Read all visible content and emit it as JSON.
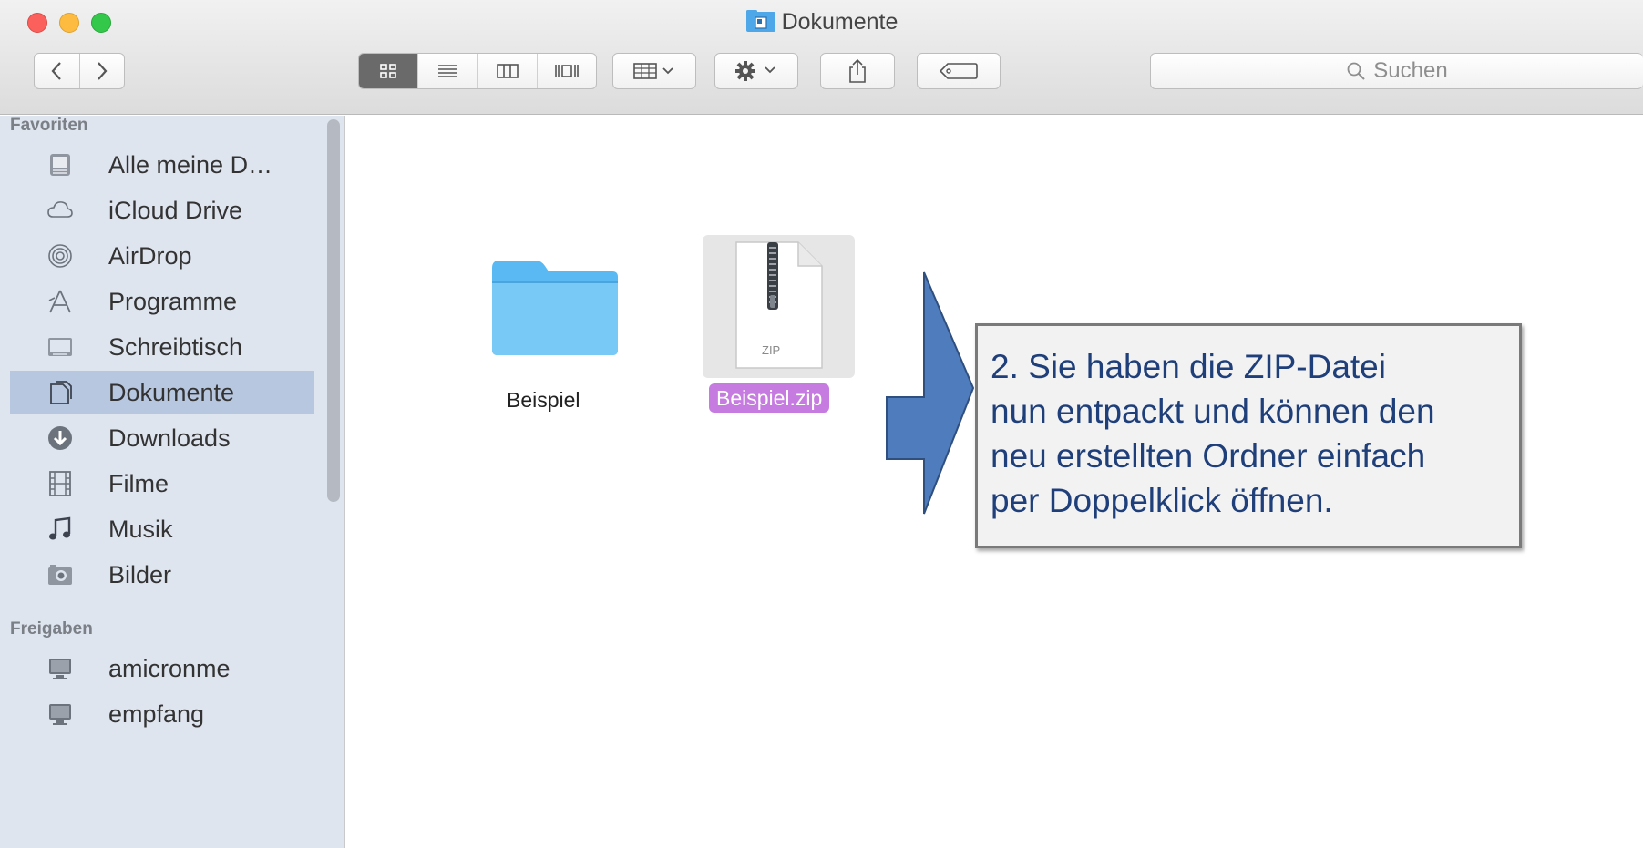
{
  "window": {
    "title": "Dokumente",
    "traffic_colors": {
      "close": "#fc605c",
      "minimize": "#fdbc40",
      "zoom": "#34c84a"
    }
  },
  "toolbar": {
    "back_icon": "chevron-left-icon",
    "forward_icon": "chevron-right-icon",
    "view_modes": [
      "icon-view",
      "list-view",
      "column-view",
      "coverflow-view"
    ],
    "active_view": "icon-view",
    "arrange_icon": "arrange-grid-icon",
    "action_icon": "gear-icon",
    "share_icon": "share-icon",
    "tag_icon": "tag-icon",
    "search_placeholder": "Suchen"
  },
  "sidebar": {
    "favorites_header": "Favoriten",
    "favorites": [
      {
        "label": "Alle meine D…",
        "icon": "all-files-icon"
      },
      {
        "label": "iCloud Drive",
        "icon": "cloud-icon"
      },
      {
        "label": "AirDrop",
        "icon": "airdrop-icon"
      },
      {
        "label": "Programme",
        "icon": "applications-icon"
      },
      {
        "label": "Schreibtisch",
        "icon": "desktop-icon"
      },
      {
        "label": "Dokumente",
        "icon": "documents-icon",
        "selected": true
      },
      {
        "label": "Downloads",
        "icon": "downloads-icon"
      },
      {
        "label": "Filme",
        "icon": "movies-icon"
      },
      {
        "label": "Musik",
        "icon": "music-icon"
      },
      {
        "label": "Bilder",
        "icon": "pictures-icon"
      }
    ],
    "shared_header": "Freigaben",
    "shared": [
      {
        "label": "amicronme",
        "icon": "computer-icon"
      },
      {
        "label": "empfang",
        "icon": "computer-icon"
      }
    ]
  },
  "content": {
    "items": [
      {
        "name": "Beispiel",
        "icon": "folder-icon",
        "selected": false
      },
      {
        "name": "Beispiel.zip",
        "icon": "zip-file-icon",
        "badge": "ZIP",
        "selected": true
      }
    ]
  },
  "callout": {
    "lines": [
      "2. Sie haben die ZIP-Datei",
      "nun entpackt und können den",
      "neu erstellten Ordner einfach",
      "per Doppelklick öffnen."
    ],
    "arrow_color": "#4f7cbd",
    "text_color": "#1f3f7a"
  },
  "colors": {
    "sidebar_bg": "#dfe5ef",
    "sidebar_selected": "#b7c7e0",
    "zip_label_bg": "#c67be0"
  }
}
